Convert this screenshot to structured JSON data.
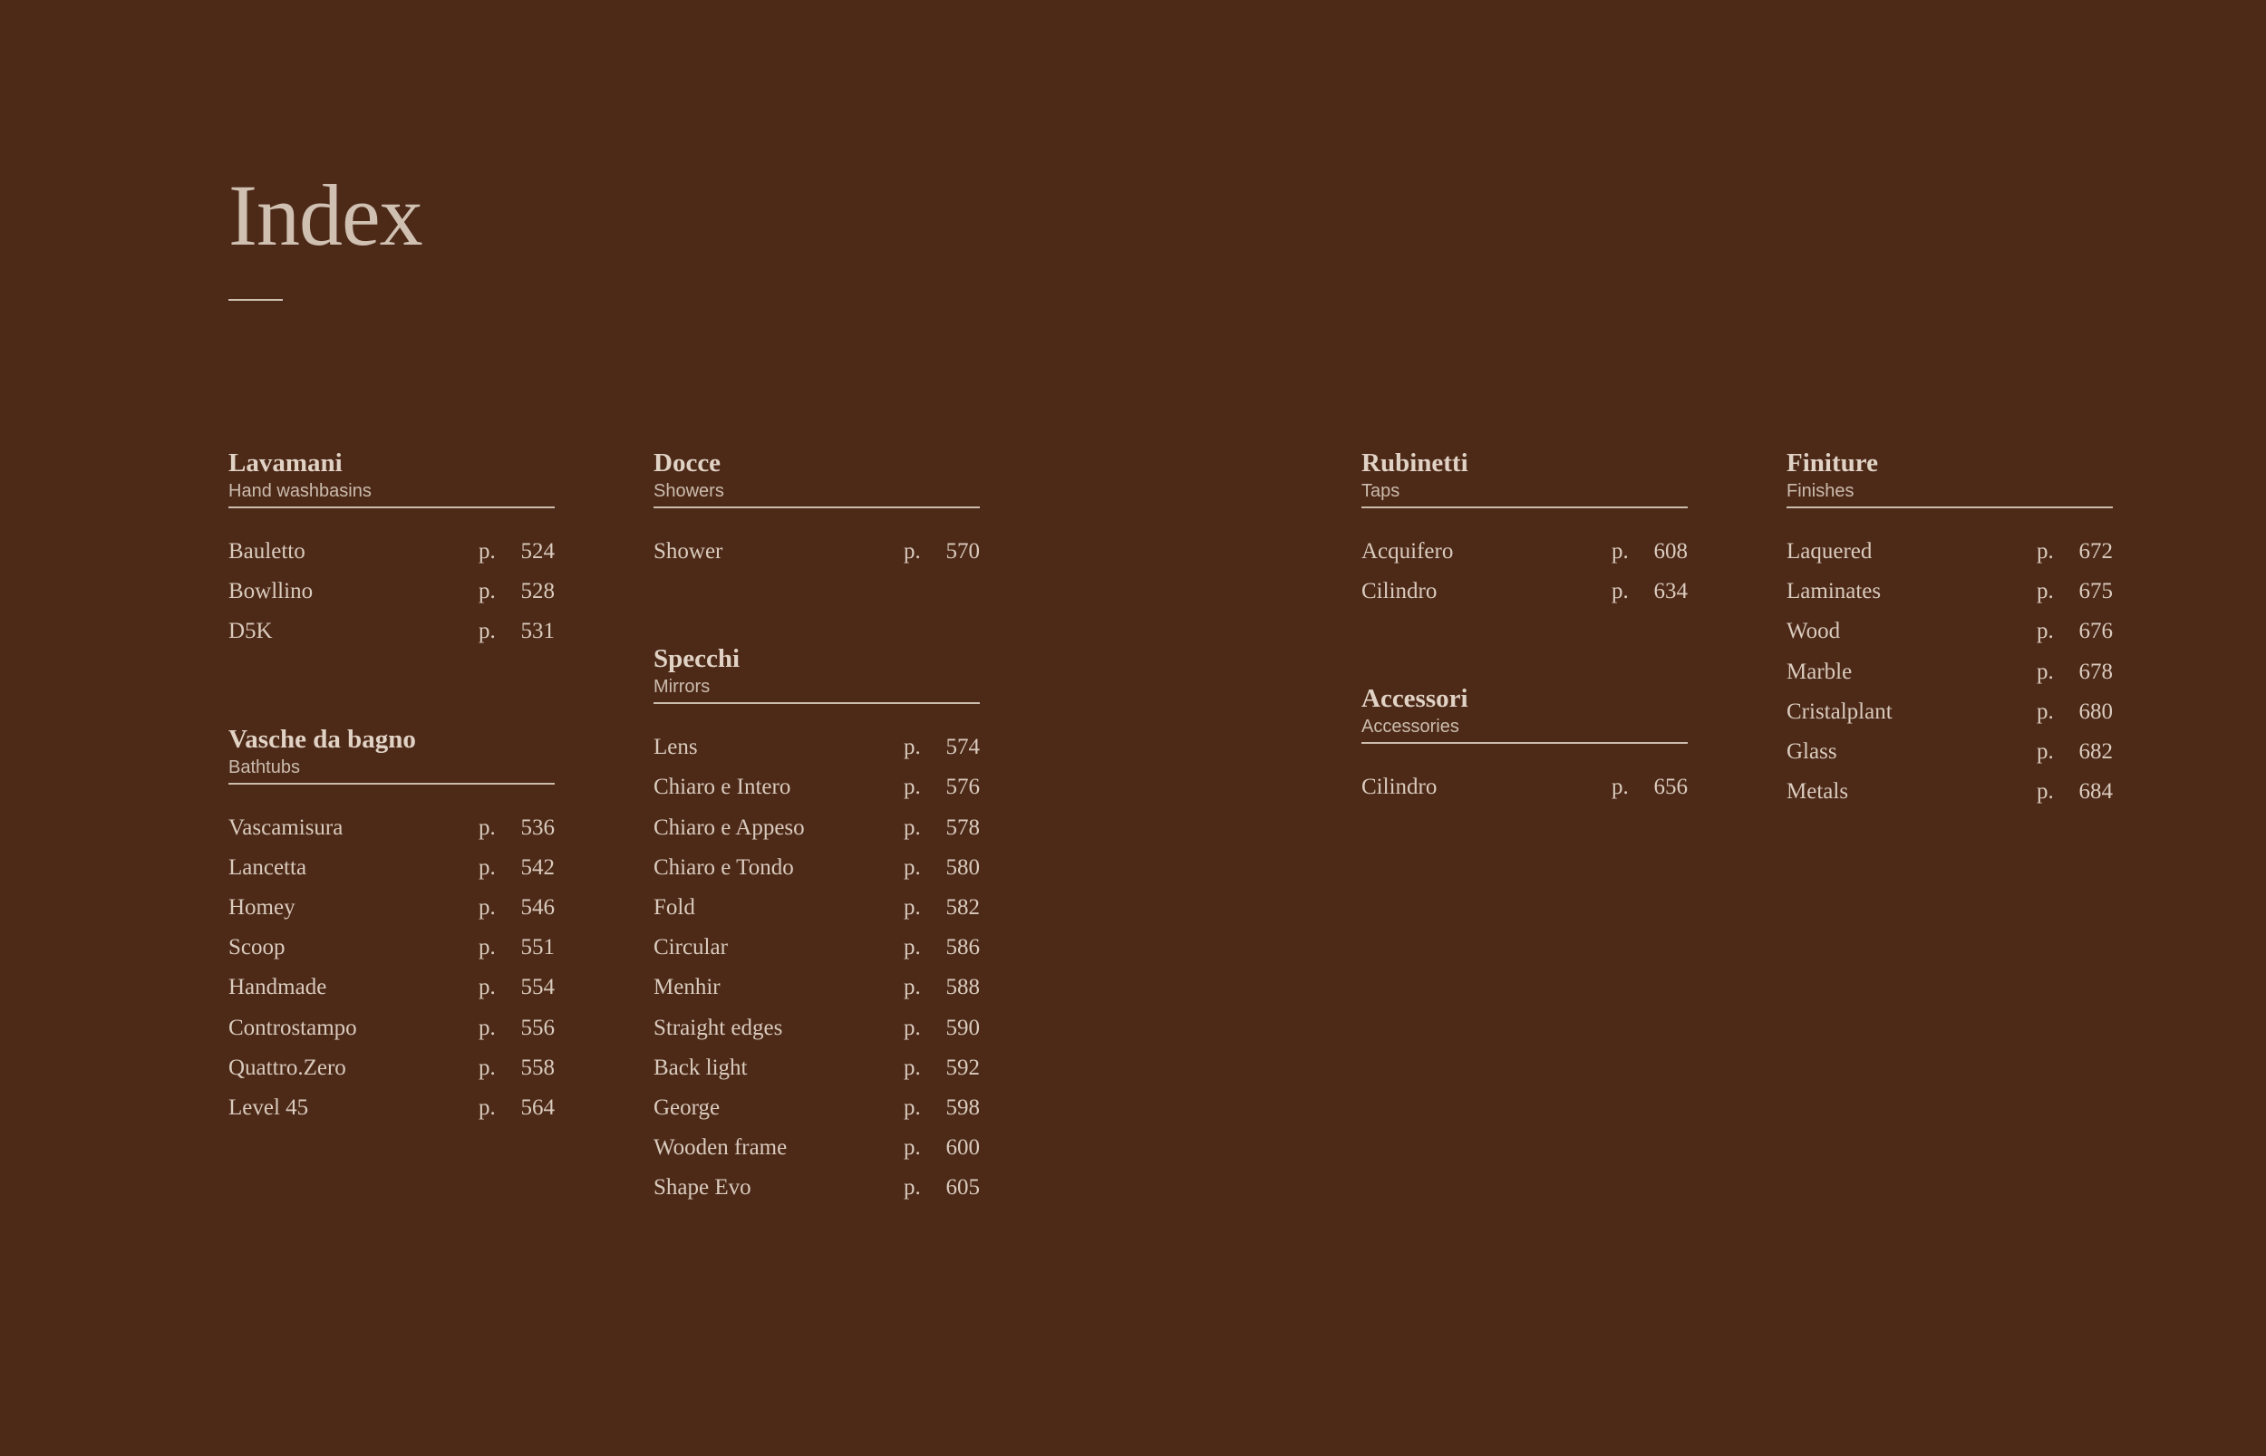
{
  "title": "Index",
  "columns": [
    {
      "sections": [
        {
          "title": "Lavamani",
          "subtitle": "Hand washbasins",
          "entries": [
            {
              "name": "Bauletto",
              "p": "p.",
              "page": "524"
            },
            {
              "name": "Bowllino",
              "p": "p.",
              "page": "528"
            },
            {
              "name": "D5K",
              "p": "p.",
              "page": "531"
            }
          ]
        },
        {
          "title": "Vasche da bagno",
          "subtitle": "Bathtubs",
          "entries": [
            {
              "name": "Vascamisura",
              "p": "p.",
              "page": "536"
            },
            {
              "name": "Lancetta",
              "p": "p.",
              "page": "542"
            },
            {
              "name": "Homey",
              "p": "p.",
              "page": "546"
            },
            {
              "name": "Scoop",
              "p": "p.",
              "page": "551"
            },
            {
              "name": "Handmade",
              "p": "p.",
              "page": "554"
            },
            {
              "name": "Controstampo",
              "p": "p.",
              "page": "556"
            },
            {
              "name": "Quattro.Zero",
              "p": "p.",
              "page": "558"
            },
            {
              "name": "Level 45",
              "p": "p.",
              "page": "564"
            }
          ]
        }
      ]
    },
    {
      "sections": [
        {
          "title": "Docce",
          "subtitle": "Showers",
          "entries": [
            {
              "name": "Shower",
              "p": "p.",
              "page": "570"
            }
          ]
        },
        {
          "title": "Specchi",
          "subtitle": "Mirrors",
          "entries": [
            {
              "name": "Lens",
              "p": "p.",
              "page": "574"
            },
            {
              "name": "Chiaro e Intero",
              "p": "p.",
              "page": "576"
            },
            {
              "name": "Chiaro e Appeso",
              "p": "p.",
              "page": "578"
            },
            {
              "name": "Chiaro e Tondo",
              "p": "p.",
              "page": "580"
            },
            {
              "name": "Fold",
              "p": "p.",
              "page": "582"
            },
            {
              "name": "Circular",
              "p": "p.",
              "page": "586"
            },
            {
              "name": "Menhir",
              "p": "p.",
              "page": "588"
            },
            {
              "name": "Straight edges",
              "p": "p.",
              "page": "590"
            },
            {
              "name": "Back light",
              "p": "p.",
              "page": "592"
            },
            {
              "name": "George",
              "p": "p.",
              "page": "598"
            },
            {
              "name": "Wooden frame",
              "p": "p.",
              "page": "600"
            },
            {
              "name": "Shape Evo",
              "p": "p.",
              "page": "605"
            }
          ]
        }
      ]
    },
    {
      "sections": [
        {
          "title": "Rubinetti",
          "subtitle": "Taps",
          "entries": [
            {
              "name": "Acquifero",
              "p": "p.",
              "page": "608"
            },
            {
              "name": "Cilindro",
              "p": "p.",
              "page": "634"
            }
          ]
        },
        {
          "title": "Accessori",
          "subtitle": "Accessories",
          "entries": [
            {
              "name": "Cilindro",
              "p": "p.",
              "page": "656"
            }
          ]
        }
      ]
    },
    {
      "sections": [
        {
          "title": "Finiture",
          "subtitle": "Finishes",
          "entries": [
            {
              "name": "Laquered",
              "p": "p.",
              "page": "672"
            },
            {
              "name": "Laminates",
              "p": "p.",
              "page": "675"
            },
            {
              "name": "Wood",
              "p": "p.",
              "page": "676"
            },
            {
              "name": "Marble",
              "p": "p.",
              "page": "678"
            },
            {
              "name": "Cristalplant",
              "p": "p.",
              "page": "680"
            },
            {
              "name": "Glass",
              "p": "p.",
              "page": "682"
            },
            {
              "name": "Metals",
              "p": "p.",
              "page": "684"
            }
          ]
        }
      ]
    }
  ]
}
